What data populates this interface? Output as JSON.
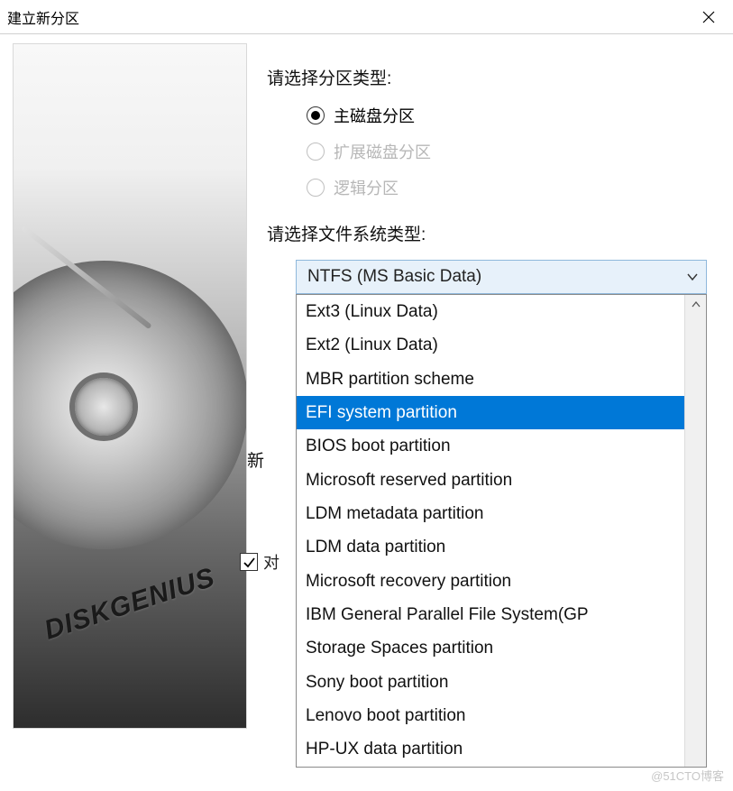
{
  "window": {
    "title": "建立新分区"
  },
  "sideImage": {
    "brand": "DISKGENIUS"
  },
  "labels": {
    "partition_type": "请选择分区类型:",
    "filesystem_type": "请选择文件系统类型:",
    "new_prefix": "新",
    "align_prefix": "对"
  },
  "radios": {
    "primary": "主磁盘分区",
    "extended": "扩展磁盘分区",
    "logical": "逻辑分区"
  },
  "combo": {
    "selected": "NTFS (MS Basic Data)"
  },
  "dropdown": {
    "items": [
      "Ext3 (Linux Data)",
      "Ext2 (Linux Data)",
      "MBR partition scheme",
      "EFI system partition",
      "BIOS boot partition",
      "Microsoft reserved partition",
      "LDM metadata partition",
      "LDM data partition",
      "Microsoft recovery partition",
      "IBM General Parallel File System(GP",
      "Storage Spaces partition",
      "Sony boot partition",
      "Lenovo boot partition",
      "HP-UX data partition"
    ],
    "highlighted_index": 3
  },
  "watermark": "@51CTO博客"
}
